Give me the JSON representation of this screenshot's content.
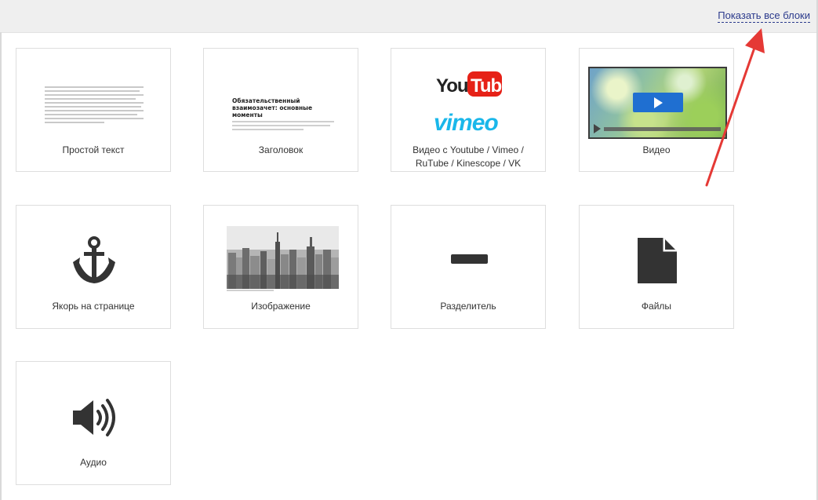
{
  "header": {
    "show_all_blocks": "Показать все блоки"
  },
  "blocks": [
    {
      "label": "Простой текст",
      "icon": "text-preview"
    },
    {
      "label": "Заголовок",
      "icon": "heading-preview",
      "preview_heading": "Обязательственный взаимозачет: основные моменты"
    },
    {
      "label_line1": "Видео с Youtube / Vimeo /",
      "label_line2": "RuTube / Kinescope / VK",
      "icon": "youtube-vimeo-logos",
      "logo_youtube_text": "You",
      "logo_youtube_box": "Tube",
      "logo_vimeo": "vimeo"
    },
    {
      "label": "Видео",
      "icon": "video-player-preview"
    },
    {
      "label": "Якорь на странице",
      "icon": "anchor-icon"
    },
    {
      "label": "Изображение",
      "icon": "city-image-preview"
    },
    {
      "label": "Разделитель",
      "icon": "divider-icon"
    },
    {
      "label": "Файлы",
      "icon": "file-icon"
    },
    {
      "label": "Аудио",
      "icon": "speaker-icon"
    }
  ],
  "colors": {
    "link": "#2b3a8c",
    "arrow": "#e53935",
    "youtube_red": "#e62117",
    "vimeo_cyan": "#1ab7ea",
    "play_blue": "#1f6fd1"
  }
}
